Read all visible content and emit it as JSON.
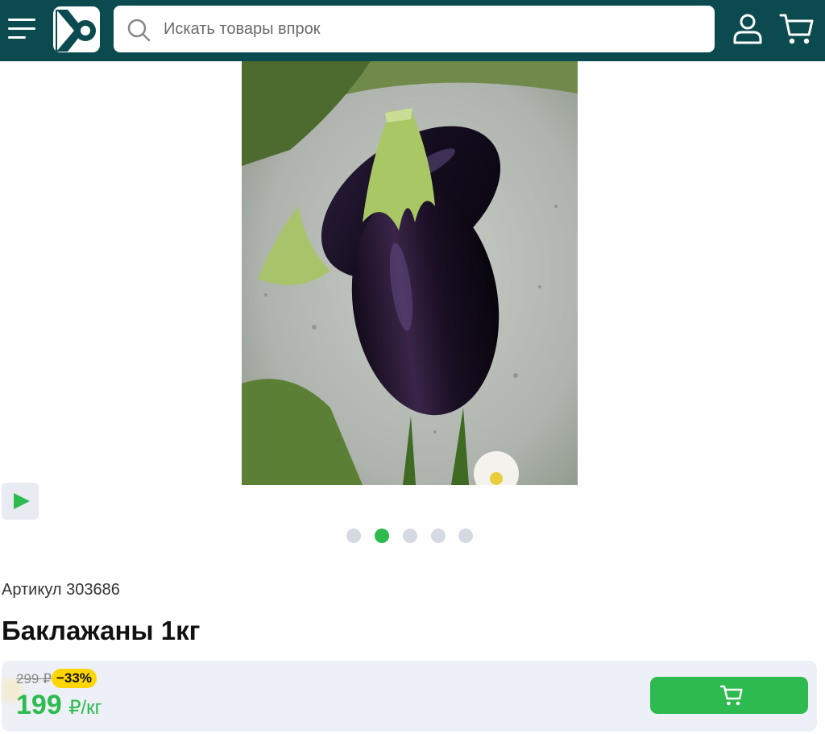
{
  "header": {
    "search_placeholder": "Искать товары впрок",
    "icons": {
      "menu": "hamburger-menu-icon",
      "logo": "brand-logo",
      "search": "search-icon",
      "user": "user-icon",
      "cart": "cart-icon"
    },
    "colors": {
      "header_bg": "#0b4a4e"
    }
  },
  "gallery": {
    "slide_count": 5,
    "active_slide": 2,
    "video_icon": "play-icon"
  },
  "product": {
    "sku_text": "Артикул 303686",
    "title": "Баклажаны 1кг"
  },
  "pricing": {
    "old_price": "299 ₽",
    "discount": "−33%",
    "price": "199",
    "unit": "₽/кг",
    "cart_icon": "cart-icon",
    "colors": {
      "accent": "#2dba4e",
      "discount_bg": "#ffd600",
      "panel_bg": "#edf0f6"
    }
  }
}
